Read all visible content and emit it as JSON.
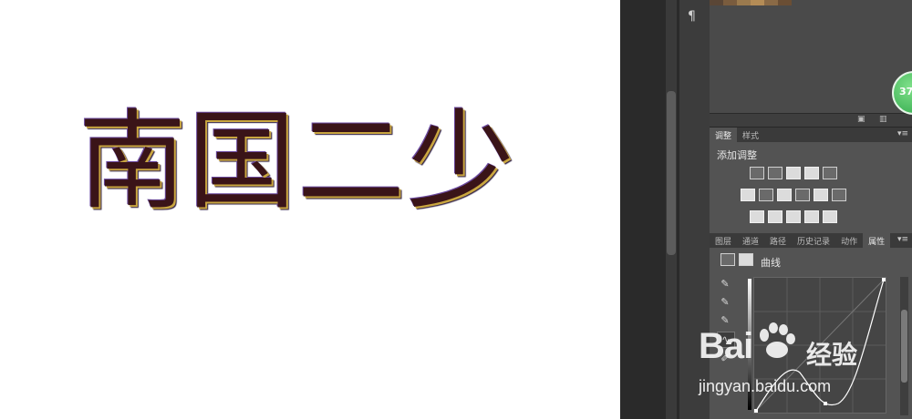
{
  "artwork": {
    "text": "南国二少"
  },
  "toolbar": {
    "paragraph_glyph": "¶"
  },
  "badge": {
    "text": "37"
  },
  "adjustments_panel": {
    "tabs": [
      "调整",
      "样式"
    ],
    "title": "添加调整",
    "icon_rows": [
      [
        "brightness-contrast-icon",
        "levels-icon",
        "curves-icon",
        "exposure-icon",
        "vibrance-icon"
      ],
      [
        "hue-saturation-icon",
        "color-balance-icon",
        "black-white-icon",
        "photo-filter-icon",
        "channel-mixer-icon",
        "color-lookup-icon"
      ],
      [
        "invert-icon",
        "posterize-icon",
        "threshold-icon",
        "gradient-map-icon",
        "selective-color-icon"
      ]
    ]
  },
  "properties_panel": {
    "tabs": [
      "图层",
      "通道",
      "路径",
      "历史记录",
      "动作",
      "属性"
    ],
    "active_tab": "属性",
    "adjustment_name": "曲线",
    "tools": [
      "eyedropper-black-icon",
      "eyedropper-gray-icon",
      "eyedropper-white-icon",
      "curve-edit-icon",
      "pencil-icon"
    ]
  },
  "watermark": {
    "logo_left": "Bai",
    "logo_right": "经验",
    "url": "jingyan.baidu.com"
  },
  "colors": {
    "artwork_text": "#3a1418",
    "panel_bg": "#535353",
    "badge": "#2fa84a"
  }
}
